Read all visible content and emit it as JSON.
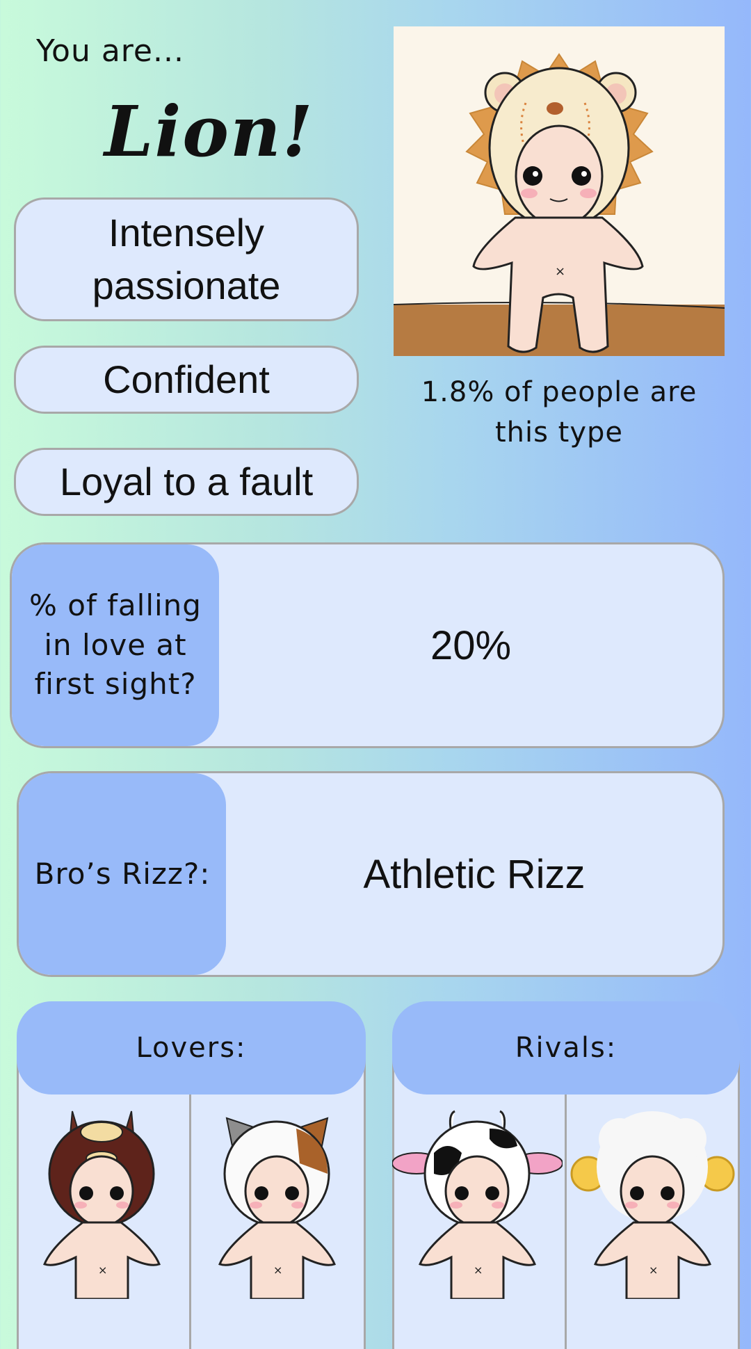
{
  "header": {
    "intro": "You are...",
    "type_name": "Lion!"
  },
  "traits": [
    "Intensely passionate",
    "Confident",
    "Loyal to a fault"
  ],
  "stat": "1.8% of people are this type",
  "cards": [
    {
      "label": "% of falling in love at first sight?",
      "value": "20%"
    },
    {
      "label": "Bro’s Rizz?:",
      "value": "Athletic Rizz"
    }
  ],
  "panels": {
    "lovers_title": "Lovers:",
    "rivals_title": "Rivals:"
  },
  "icons": [
    "lion-figure-icon",
    "horse-figure-icon",
    "cat-figure-icon",
    "cow-figure-icon",
    "sheep-figure-icon"
  ]
}
